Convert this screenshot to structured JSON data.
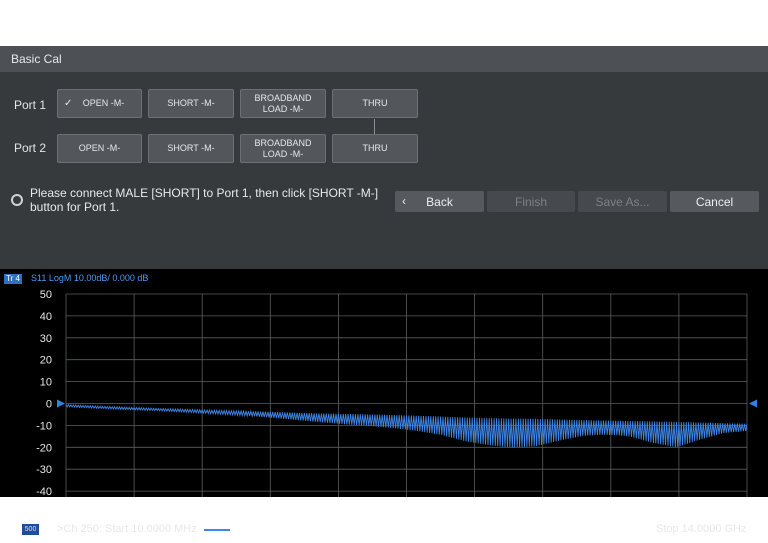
{
  "dialog": {
    "title": "Basic Cal"
  },
  "ports": [
    {
      "label": "Port 1",
      "buttons": [
        "OPEN -M-",
        "SHORT -M-",
        "BROADBAND\nLOAD -M-",
        "THRU"
      ],
      "open_checked": true
    },
    {
      "label": "Port 2",
      "buttons": [
        "OPEN -M-",
        "SHORT -M-",
        "BROADBAND\nLOAD -M-",
        "THRU"
      ]
    }
  ],
  "checkmark": "✓",
  "status": {
    "message": "Please connect MALE [SHORT] to Port 1, then click [SHORT -M-] button for Port 1."
  },
  "actions": {
    "back": "Back",
    "back_icon": "‹",
    "finish": "Finish",
    "save_as": "Save As...",
    "cancel": "Cancel",
    "finish_enabled": false,
    "save_as_enabled": false
  },
  "trace": {
    "badge": "Tr 4",
    "label": "S11 LogM 10.00dB/ 0.000 dB",
    "color": "#3f86e6",
    "ref_marker_color": "#2f80e8"
  },
  "channel": {
    "badge": "500",
    "text": ">Ch 250:  Start  10.0000 MHz",
    "stop": "Stop  14.0000 GHz"
  },
  "chart_data": {
    "type": "line",
    "xlabel": "",
    "ylabel": "",
    "ylim": [
      -50,
      50
    ],
    "yticks": [
      50,
      40,
      30,
      20,
      10,
      0,
      -10,
      -20,
      -30,
      -40,
      -50
    ],
    "x_start": "10.0000 MHz",
    "x_stop": "14.0000 GHz",
    "reference_level": 0,
    "series": [
      {
        "values": [
          -1.0,
          -1.5,
          -2.0,
          -2.4,
          -2.8,
          -3.3,
          -3.7,
          -4.2,
          -4.7,
          -5.3,
          -6.0,
          -6.6,
          -7.2,
          -7.6,
          -8.3,
          -9.0,
          -10.2,
          -11.8,
          -14.0,
          -17.0,
          -18.5,
          -16.0,
          -13.5,
          -12.5,
          -13.0,
          -15.0,
          -17.5,
          -14.0,
          -12.0,
          -11.0
        ],
        "envelope_high": [
          -0.5,
          -1.0,
          -1.5,
          -1.9,
          -2.3,
          -2.6,
          -3.0,
          -3.3,
          -3.6,
          -3.9,
          -4.3,
          -4.6,
          -4.8,
          -5.0,
          -5.3,
          -5.6,
          -6.0,
          -6.4,
          -6.7,
          -6.9,
          -7.0,
          -7.3,
          -7.6,
          -7.8,
          -8.0,
          -8.2,
          -8.4,
          -8.7,
          -9.0,
          -9.3
        ],
        "envelope_low": [
          -1.5,
          -2.0,
          -2.5,
          -2.9,
          -3.3,
          -3.9,
          -4.5,
          -5.1,
          -5.8,
          -6.7,
          -7.7,
          -8.7,
          -9.6,
          -10.3,
          -11.3,
          -12.6,
          -14.4,
          -17.2,
          -19.0,
          -20.2,
          -19.5,
          -17.0,
          -14.8,
          -14.2,
          -15.0,
          -18.0,
          -20.0,
          -16.5,
          -13.5,
          -12.5
        ]
      }
    ]
  }
}
